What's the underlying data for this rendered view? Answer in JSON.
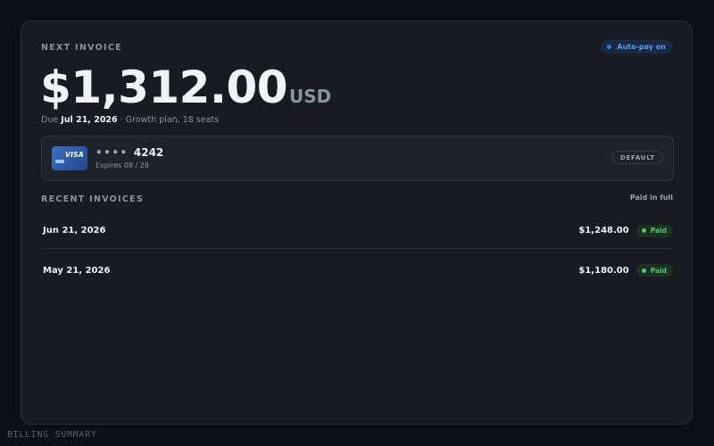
{
  "next_invoice": {
    "eyebrow": "NEXT INVOICE",
    "autopay_label": "Auto-pay on",
    "amount": "$1,312.00",
    "currency": "USD",
    "due_prefix": "Due",
    "due_date": "Jul 21, 2026",
    "plan_detail": "· Growth plan, 18 seats"
  },
  "payment_method": {
    "brand": "VISA",
    "masked_dots": "••••",
    "last4": "4242",
    "expires": "Expires 08 / 28",
    "badge": "DEFAULT"
  },
  "recent_invoices": {
    "heading": "RECENT INVOICES",
    "status_summary": "Paid in full",
    "items": [
      {
        "date": "Jun 21, 2026",
        "amount": "$1,248.00",
        "status": "Paid"
      },
      {
        "date": "May 21, 2026",
        "amount": "$1,180.00",
        "status": "Paid"
      }
    ]
  },
  "footer_label": "BILLING SUMMARY",
  "colors": {
    "accent_blue": "#5c9bf2",
    "paid_green": "#4cc66c",
    "card_bg": "#181b20"
  },
  "icons": {
    "autopay": "status-dot-icon",
    "card": "visa-card-icon",
    "paid": "status-dot-icon"
  }
}
